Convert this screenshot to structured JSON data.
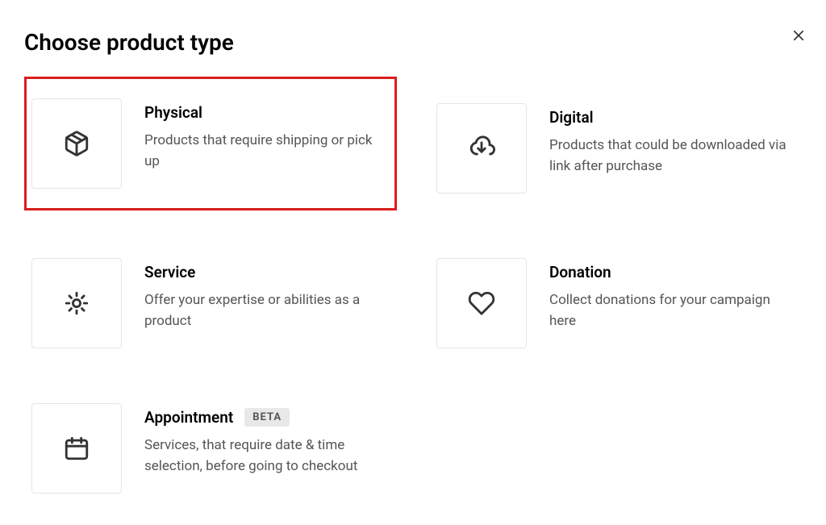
{
  "title": "Choose product type",
  "product_types": [
    {
      "key": "physical",
      "title": "Physical",
      "description": "Products that require shipping or pick up",
      "highlighted": true
    },
    {
      "key": "digital",
      "title": "Digital",
      "description": "Products that could be downloaded via link after purchase",
      "highlighted": false
    },
    {
      "key": "service",
      "title": "Service",
      "description": "Offer your expertise or abilities as a product",
      "highlighted": false
    },
    {
      "key": "donation",
      "title": "Donation",
      "description": "Collect donations for your campaign here",
      "highlighted": false
    },
    {
      "key": "appointment",
      "title": "Appointment",
      "description": "Services, that require date & time selection, before going to checkout",
      "badge": "BETA",
      "highlighted": false
    }
  ]
}
